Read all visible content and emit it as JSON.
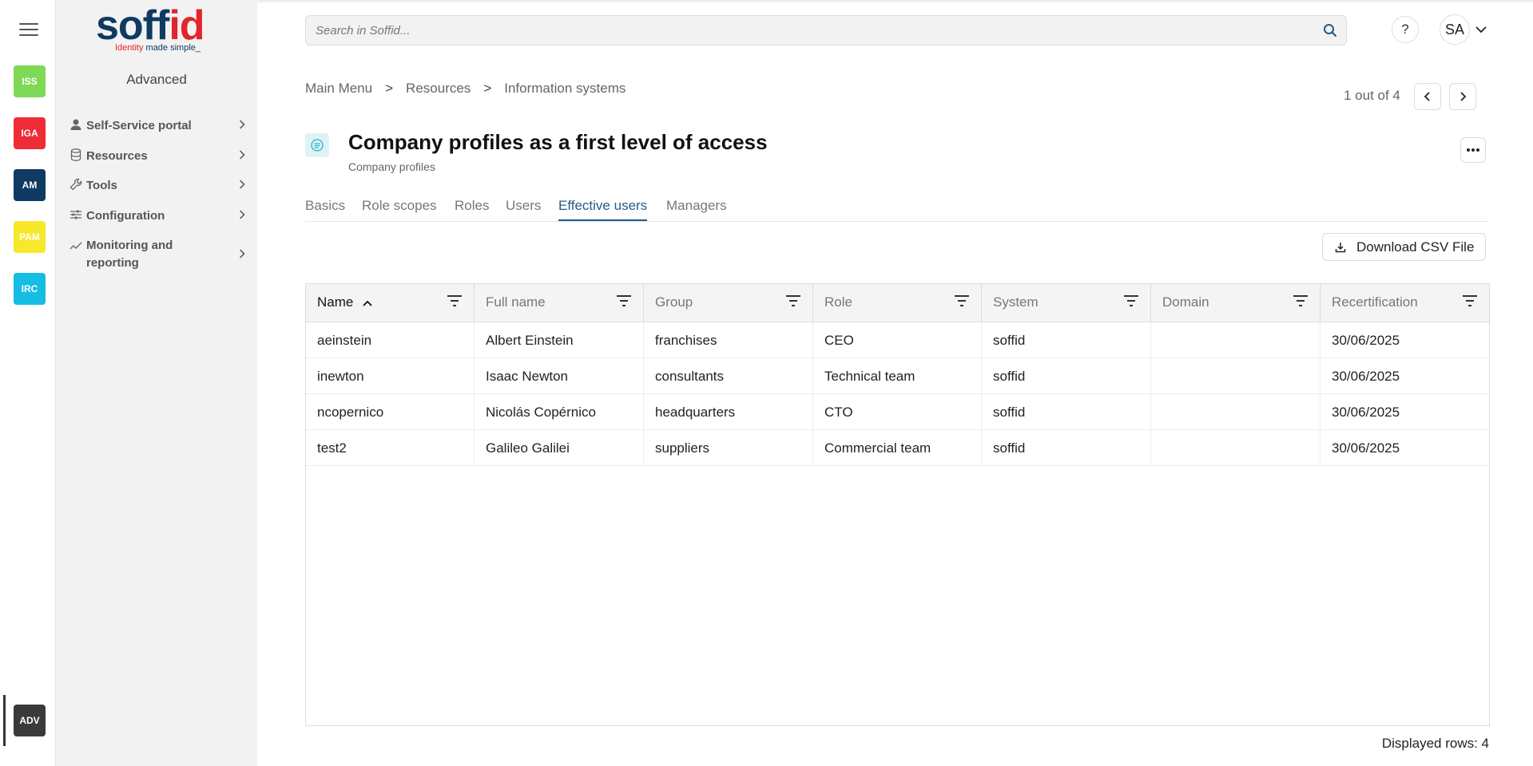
{
  "rail": {
    "modules": [
      {
        "label": "ISS",
        "color": "#7ed957"
      },
      {
        "label": "IGA",
        "color": "#ee2b36"
      },
      {
        "label": "AM",
        "color": "#0f3a61"
      },
      {
        "label": "PAM",
        "color": "#f8e82a"
      },
      {
        "label": "IRC",
        "color": "#15bde3"
      }
    ],
    "active_module": {
      "label": "ADV",
      "color": "#3a3a3a"
    }
  },
  "logo": {
    "word_main": "soff",
    "word_accent": "id",
    "tagline_accent": "Identity",
    "tagline_rest": " made simple_"
  },
  "sidebar": {
    "heading": "Advanced",
    "items": [
      {
        "label": "Self-Service portal",
        "icon": "person-icon"
      },
      {
        "label": "Resources",
        "icon": "database-icon"
      },
      {
        "label": "Tools",
        "icon": "wrench-icon"
      },
      {
        "label": "Configuration",
        "icon": "sliders-icon"
      },
      {
        "label": "Monitoring and reporting",
        "icon": "chart-line-icon"
      }
    ]
  },
  "topbar": {
    "search_placeholder": "Search in Soffid...",
    "help_label": "?",
    "avatar_initials": "SA"
  },
  "breadcrumb": {
    "items": [
      "Main Menu",
      "Resources",
      "Information systems"
    ],
    "separator": ">"
  },
  "pager": {
    "text": "1 out of 4"
  },
  "page": {
    "title": "Company profiles as a first level of access",
    "subtitle": "Company profiles"
  },
  "tabs": [
    {
      "label": "Basics"
    },
    {
      "label": "Role scopes"
    },
    {
      "label": "Roles"
    },
    {
      "label": "Users"
    },
    {
      "label": "Effective users",
      "active": true
    },
    {
      "label": "Managers"
    }
  ],
  "toolbar": {
    "download_label": "Download CSV File"
  },
  "table": {
    "columns": [
      "Name",
      "Full name",
      "Group",
      "Role",
      "System",
      "Domain",
      "Recertification"
    ],
    "sorted_column": "Name",
    "rows": [
      [
        "aeinstein",
        "Albert Einstein",
        "franchises",
        "CEO",
        "soffid",
        "",
        "30/06/2025"
      ],
      [
        "inewton",
        "Isaac Newton",
        "consultants",
        "Technical team",
        "soffid",
        "",
        "30/06/2025"
      ],
      [
        "ncopernico",
        "Nicolás Copérnico",
        "headquarters",
        "CTO",
        "soffid",
        "",
        "30/06/2025"
      ],
      [
        "test2",
        "Galileo Galilei",
        "suppliers",
        "Commercial team",
        "soffid",
        "",
        "30/06/2025"
      ]
    ]
  },
  "footer": {
    "rows_label": "Displayed rows: 4"
  },
  "colors": {
    "accent": "#1f5c8c",
    "brand_blue": "#0f3a61",
    "brand_red": "#e1252a"
  }
}
